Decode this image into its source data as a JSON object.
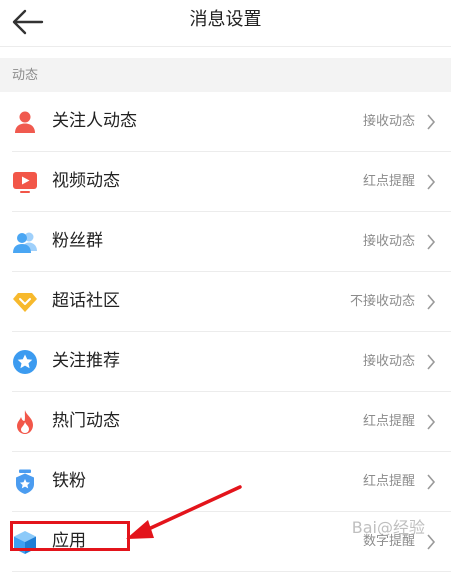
{
  "header": {
    "title": "消息设置"
  },
  "section": {
    "label": "动态"
  },
  "rows": [
    {
      "label": "关注人动态",
      "value": "接收动态",
      "icon": "person-icon",
      "color": "#f05a4f"
    },
    {
      "label": "视频动态",
      "value": "红点提醒",
      "icon": "video-play-icon",
      "color": "#f25648"
    },
    {
      "label": "粉丝群",
      "value": "接收动态",
      "icon": "group-icon",
      "color": "#4aa6f3"
    },
    {
      "label": "超话社区",
      "value": "不接收动态",
      "icon": "diamond-icon",
      "color": "#f7b92d"
    },
    {
      "label": "关注推荐",
      "value": "接收动态",
      "icon": "star-badge-icon",
      "color": "#3c9bf0"
    },
    {
      "label": "热门动态",
      "value": "红点提醒",
      "icon": "flame-icon",
      "color": "#f2574a"
    },
    {
      "label": "铁粉",
      "value": "红点提醒",
      "icon": "shield-badge-icon",
      "color": "#4b9cf0"
    },
    {
      "label": "应用",
      "value": "数字提醒",
      "icon": "cube-icon",
      "color": "#3ea0f2"
    }
  ],
  "watermark": {
    "text": "Bai@经验"
  },
  "colors": {
    "highlight": "#e3141b",
    "divider": "#ececec",
    "section_bg": "#f3f3f3"
  }
}
